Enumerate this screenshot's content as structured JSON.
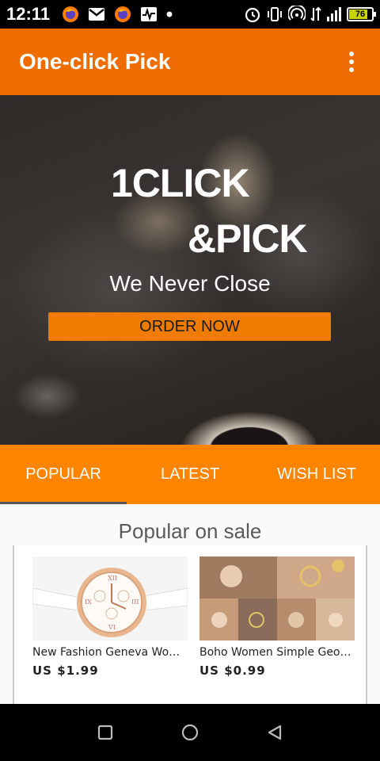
{
  "status_bar": {
    "time": "12:11",
    "battery_level": "76",
    "icons": [
      "firefox-icon",
      "gmail-icon",
      "firefox-icon",
      "activity-icon",
      "notification-dot-icon",
      "alarm-icon",
      "vibrate-icon",
      "hotspot-icon",
      "data-arrows-icon",
      "signal-icon",
      "battery-icon"
    ]
  },
  "app_bar": {
    "title": "One-click Pick",
    "menu_icon": "more-vert-icon"
  },
  "hero": {
    "title_line1": "1CLICK",
    "title_line2": "&PICK",
    "subtitle": "We Never Close",
    "cta_label": "ORDER NOW"
  },
  "tabs": [
    {
      "label": "POPULAR",
      "active": true
    },
    {
      "label": "LATEST",
      "active": false
    },
    {
      "label": "WISH LIST",
      "active": false
    }
  ],
  "section": {
    "title": "Popular on sale"
  },
  "products": [
    {
      "name": "New Fashion Geneva Women...",
      "price": "US $1.99"
    },
    {
      "name": "Boho Women Simple Geometric...",
      "price": "US $0.99"
    }
  ],
  "colors": {
    "app_bar": "#ef6c00",
    "tabs": "#ff8400",
    "cta": "#ef7c00"
  },
  "nav_bar": {
    "icons": [
      "recents-square-icon",
      "home-circle-icon",
      "back-triangle-icon"
    ]
  }
}
